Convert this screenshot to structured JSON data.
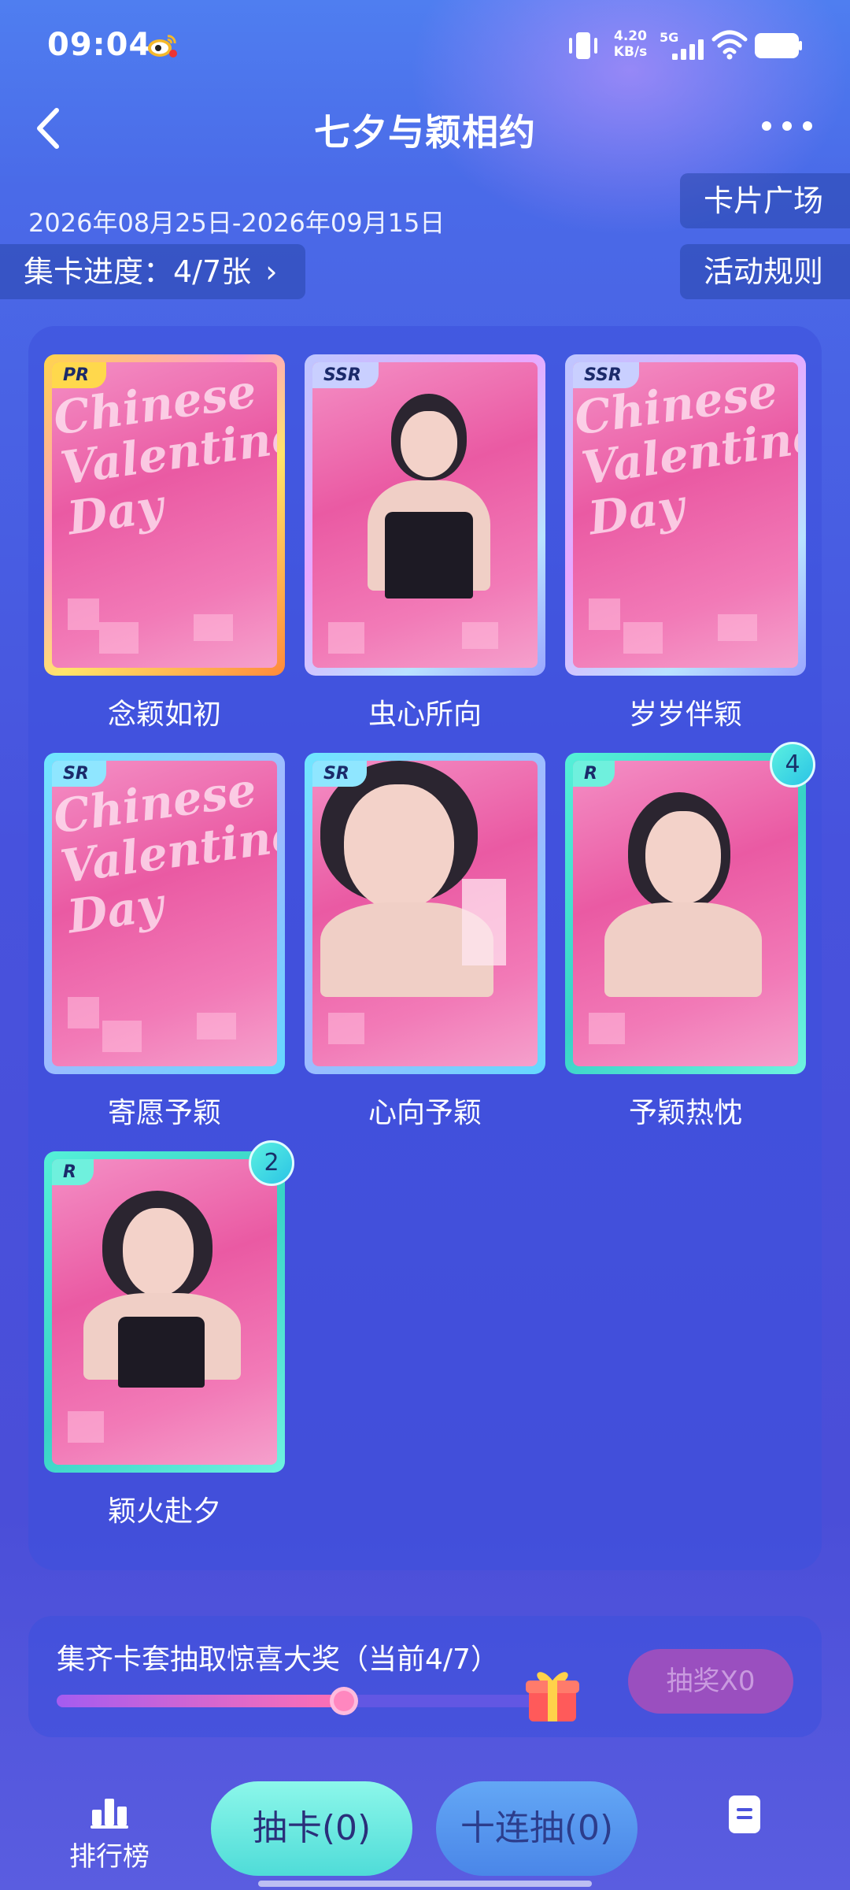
{
  "status_bar": {
    "time": "09:04",
    "net_speed_value": "4.20",
    "net_speed_unit": "KB/s",
    "network": "5G",
    "app_icon": "weibo-icon"
  },
  "header": {
    "title": "七夕与颖相约",
    "back_icon": "back-arrow-icon",
    "more_icon": "more-dots-icon"
  },
  "info": {
    "date_range": "2026年08月25日-2026年09月15日",
    "progress_label": "集卡进度：4/7张",
    "card_square_label": "卡片广场",
    "rules_label": "活动规则"
  },
  "cards": [
    {
      "name": "念颖如初",
      "rarity": "PR",
      "script": "Chinese Valentine Day"
    },
    {
      "name": "虫心所向",
      "rarity": "SSR"
    },
    {
      "name": "岁岁伴颖",
      "rarity": "SSR",
      "script": "Chinese Valentine Day"
    },
    {
      "name": "寄愿予颖",
      "rarity": "SR",
      "script": "Chinese Valentine Day"
    },
    {
      "name": "心向予颖",
      "rarity": "SR"
    },
    {
      "name": "予颖热忱",
      "rarity": "R",
      "count": "4"
    },
    {
      "name": "颖火赴夕",
      "rarity": "R",
      "count": "2"
    }
  ],
  "reward": {
    "text": "集齐卡套抽取惊喜大奖（当前4/7）",
    "progress": 0.571,
    "button_label": "抽奖X0"
  },
  "bottom_nav": {
    "rank_label": "排行榜",
    "draw_label": "抽卡(0)",
    "ten_draw_label": "十连抽(0)"
  },
  "colors": {
    "background": "#4a52dd",
    "panel": "#4b5ee0",
    "draw_button": "#5fe6df",
    "ten_draw_button": "#5a98ee",
    "prize_button": "#9a4fbf"
  }
}
